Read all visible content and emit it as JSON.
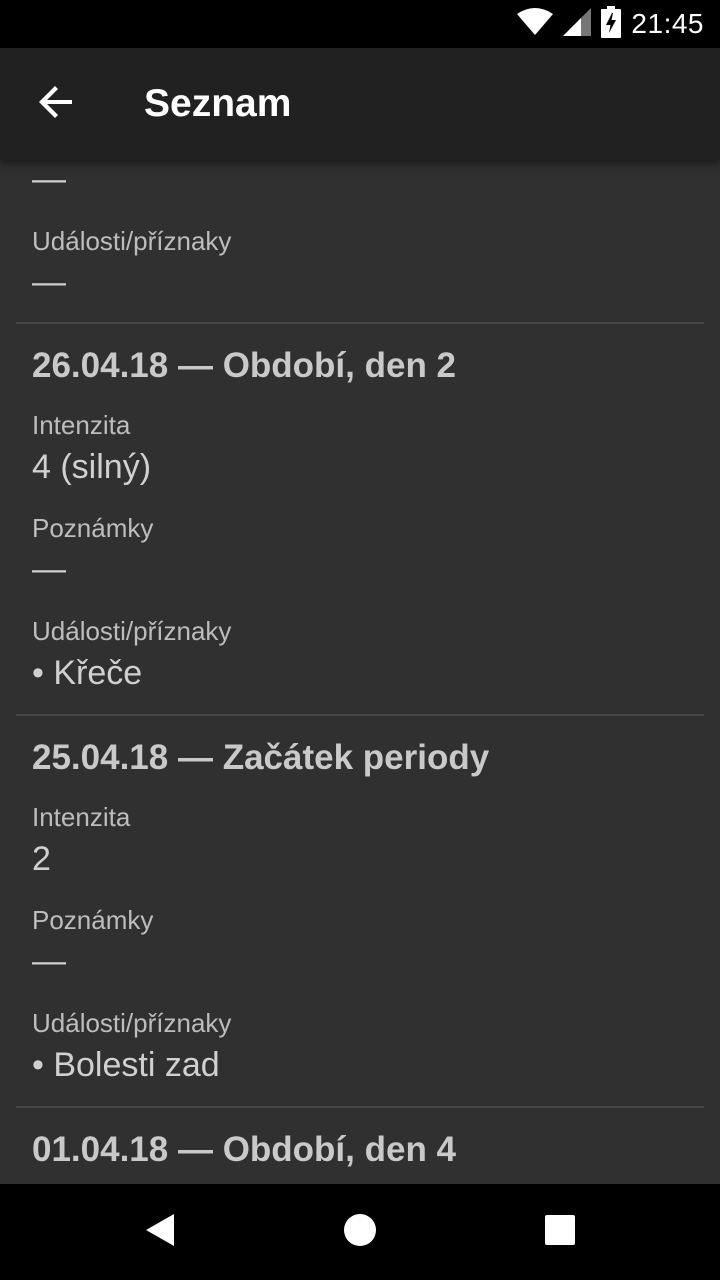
{
  "status_bar": {
    "time": "21:45"
  },
  "app_bar": {
    "title": "Seznam"
  },
  "partial_top": {
    "value_top": "—",
    "events_label": "Události/příznaky",
    "events_value": "—"
  },
  "entries": [
    {
      "heading": "26.04.18 — Období, den 2",
      "intensity_label": "Intenzita",
      "intensity_value": "4 (silný)",
      "notes_label": "Poznámky",
      "notes_value": "—",
      "events_label": "Události/příznaky",
      "events_value": "• Křeče"
    },
    {
      "heading": "25.04.18 — Začátek periody",
      "intensity_label": "Intenzita",
      "intensity_value": "2",
      "notes_label": "Poznámky",
      "notes_value": "—",
      "events_label": "Události/příznaky",
      "events_value": "• Bolesti zad"
    },
    {
      "heading": "01.04.18 — Období, den 4"
    }
  ]
}
